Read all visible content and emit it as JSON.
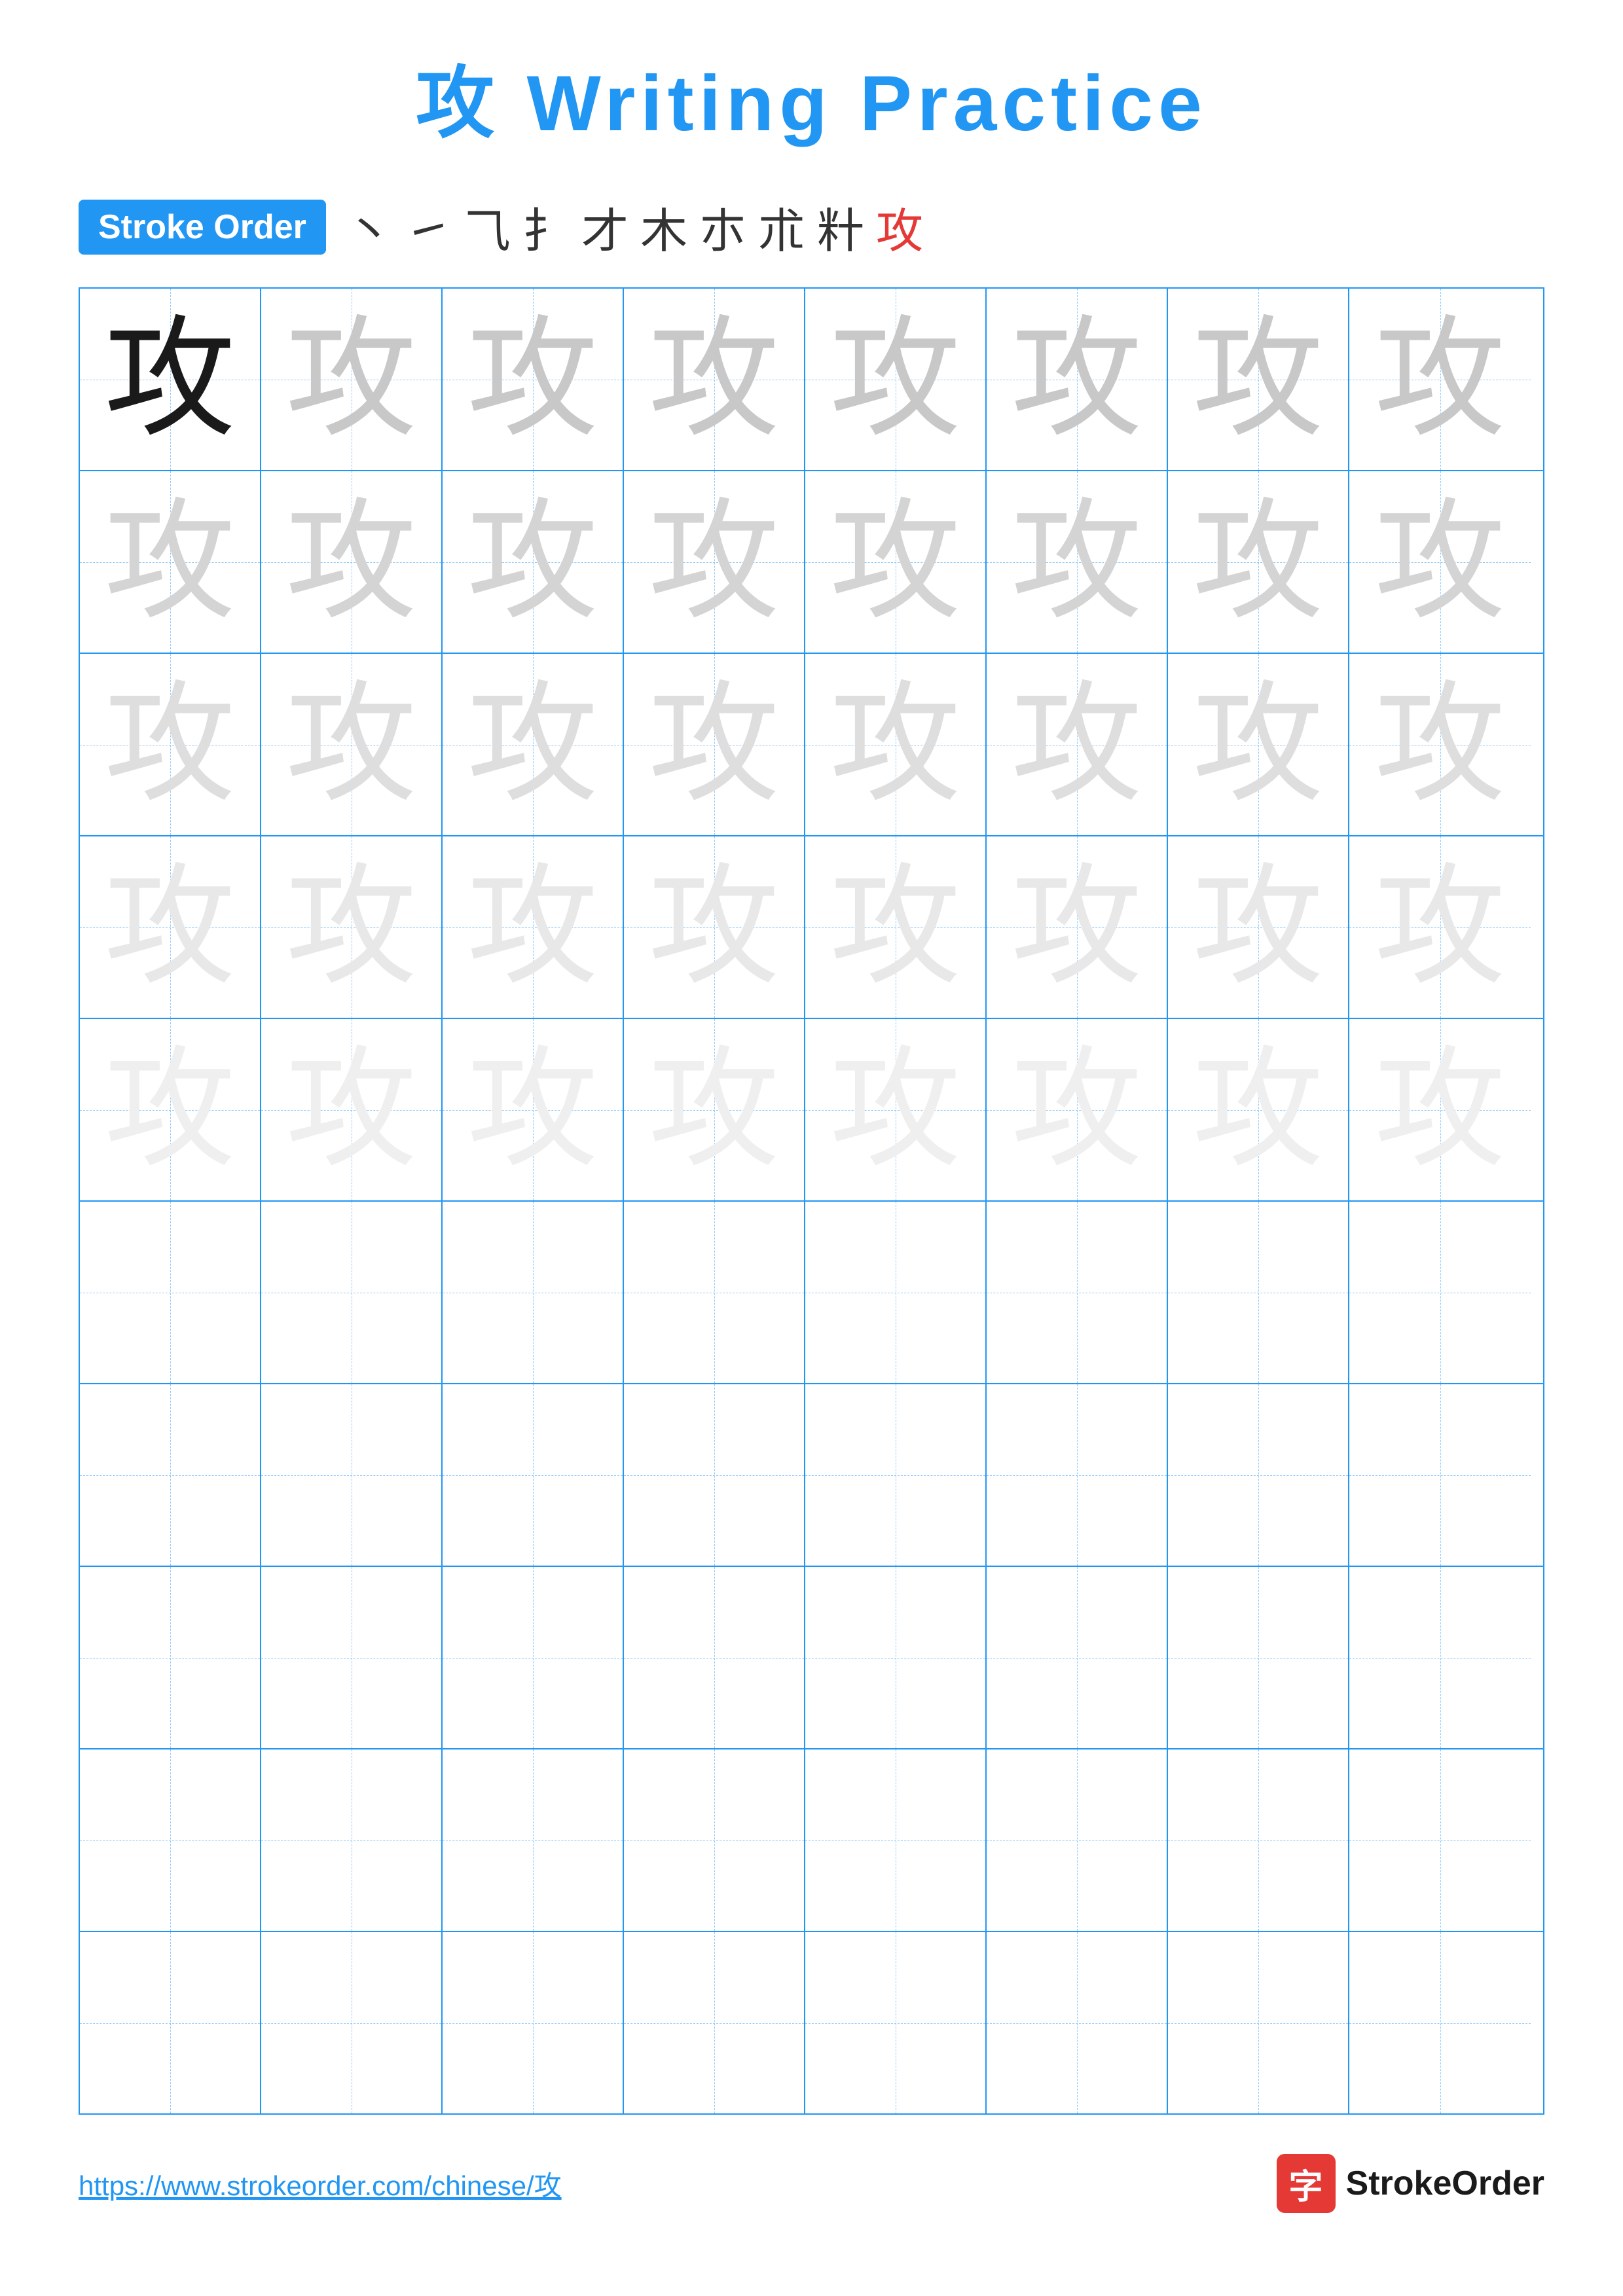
{
  "page": {
    "title": "攻 Writing Practice",
    "title_char": "攻",
    "title_suffix": " Writing Practice"
  },
  "stroke_order": {
    "badge_label": "Stroke Order",
    "strokes": [
      "丶",
      "㇀",
      "⺄",
      "扌",
      "才",
      "木",
      "朩",
      "朮",
      "籵",
      "攻"
    ]
  },
  "grid": {
    "rows": 10,
    "cols": 8,
    "char": "攻",
    "guide_rows": 5,
    "empty_rows": 5
  },
  "footer": {
    "url": "https://www.strokeorder.com/chinese/攻",
    "logo_text": "StrokeOrder",
    "logo_char": "字"
  }
}
